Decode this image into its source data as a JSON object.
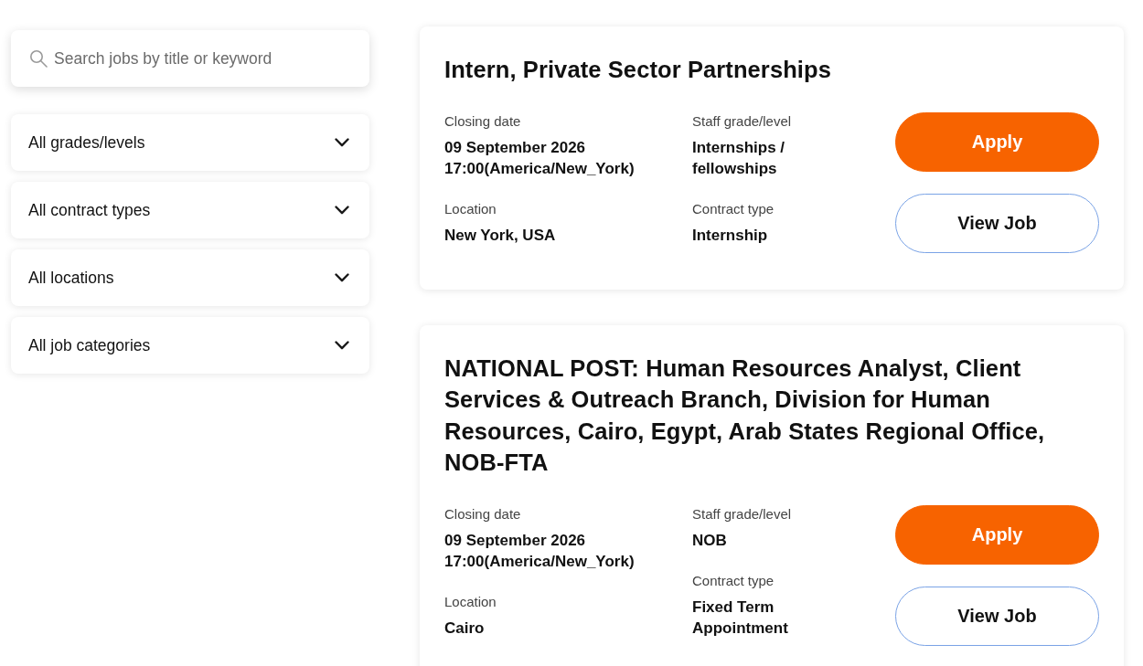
{
  "search": {
    "placeholder": "Search jobs by title or keyword"
  },
  "filters": [
    {
      "label": "All grades/levels"
    },
    {
      "label": "All contract types"
    },
    {
      "label": "All locations"
    },
    {
      "label": "All job categories"
    }
  ],
  "jobs": [
    {
      "title": "Intern, Private Sector Partnerships",
      "closing_date": {
        "label": "Closing date",
        "value": "09 September 2026 17:00(America/New_York)"
      },
      "location": {
        "label": "Location",
        "value": "New York, USA"
      },
      "staff_grade": {
        "label": "Staff grade/level",
        "value": "Internships / fellowships"
      },
      "contract_type": {
        "label": "Contract type",
        "value": "Internship"
      },
      "buttons": [
        {
          "label": "Apply",
          "kind": "primary"
        },
        {
          "label": "View Job",
          "kind": "secondary"
        }
      ]
    },
    {
      "title": "NATIONAL POST: Human Resources Analyst, Client Services & Outreach Branch, Division for Human Resources, Cairo, Egypt, Arab States Regional Office, NOB-FTA",
      "closing_date": {
        "label": "Closing date",
        "value": "09 September 2026 17:00(America/New_York)"
      },
      "location": {
        "label": "Location",
        "value": "Cairo"
      },
      "staff_grade": {
        "label": "Staff grade/level",
        "value": "NOB"
      },
      "contract_type": {
        "label": "Contract type",
        "value": "Fixed Term Appointment"
      },
      "buttons": [
        {
          "label": "Apply",
          "kind": "primary"
        },
        {
          "label": "View Job",
          "kind": "secondary"
        }
      ]
    }
  ]
}
